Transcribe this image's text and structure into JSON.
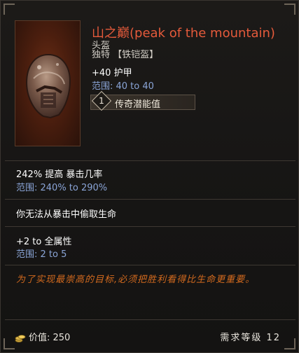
{
  "item": {
    "name": "山之巅(peak of the mountain)",
    "type": "头盔",
    "rarity": "独特 【铁铠盔】",
    "armor": "+40 护甲",
    "armor_range": "范围: 40 to 40",
    "legendary_rank": "1",
    "legendary_label": "传奇潜能值"
  },
  "affixes": [
    {
      "text": "242% 提高 暴击几率",
      "range": "范围: 240% to 290%"
    },
    {
      "text": "你无法从暴击中偷取生命"
    },
    {
      "text": "+2 to 全属性",
      "range": "范围: 2 to 5"
    }
  ],
  "flavor_text": "为了实现最崇高的目标,必须把胜利看得比生命更重要。",
  "footer": {
    "value_label": "价值: 250",
    "level_requirement": "需求等级 12"
  },
  "colors": {
    "name": "#e55a3b",
    "range": "#8aa4d6",
    "flavor": "#d36a1e",
    "background": "#161514"
  },
  "icons": [
    "helmet-icon",
    "gold-coins-icon",
    "legendary-rank-diamond-icon"
  ]
}
